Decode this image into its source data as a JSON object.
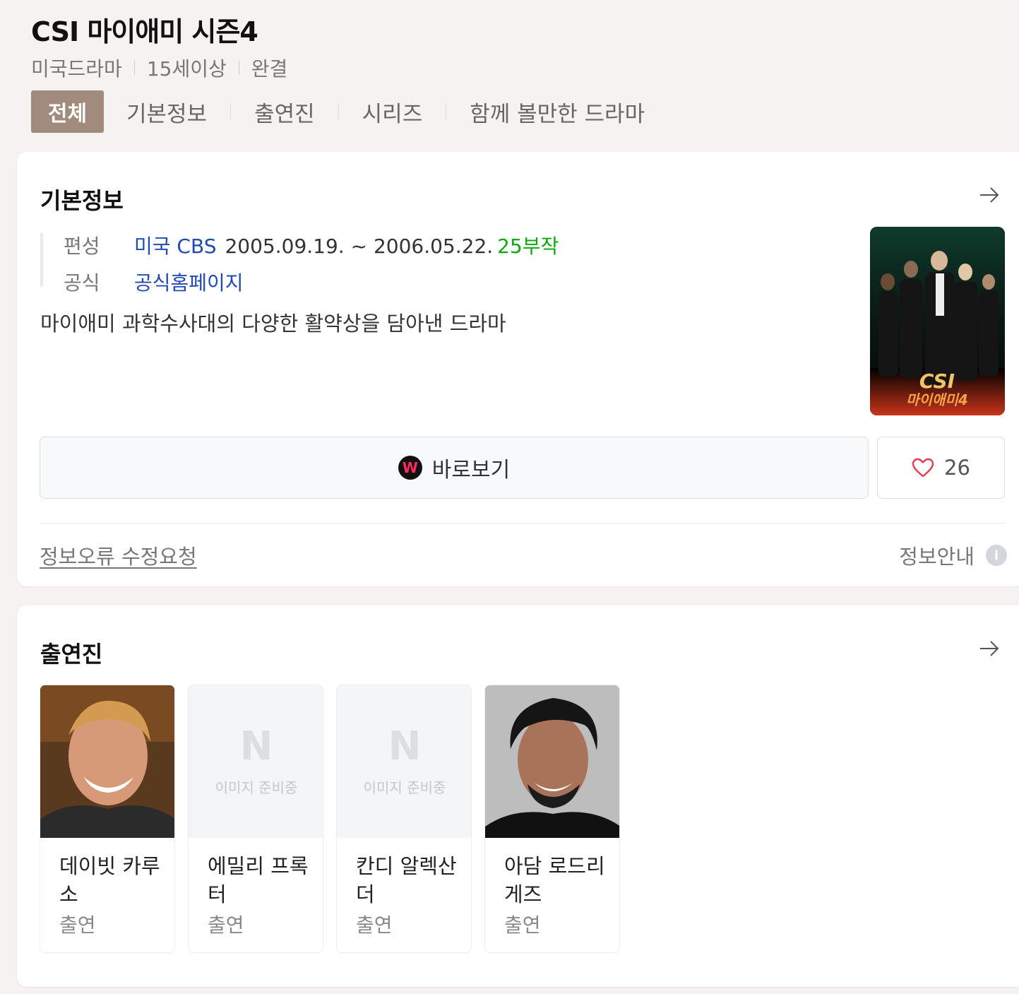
{
  "header": {
    "title": "CSI 마이애미 시즌4",
    "meta": [
      "미국드라마",
      "15세이상",
      "완결"
    ],
    "tabs": [
      {
        "label": "전체",
        "active": true
      },
      {
        "label": "기본정보"
      },
      {
        "label": "출연진"
      },
      {
        "label": "시리즈"
      },
      {
        "label": "함께 볼만한 드라마"
      }
    ]
  },
  "basic": {
    "title": "기본정보",
    "broadcast_label": "편성",
    "network": "미국 CBS",
    "dates": "2005.09.19. ~ 2006.05.22.",
    "episodes": "25부작",
    "official_label": "공식",
    "homepage": "공식홈페이지",
    "description": "마이애미 과학수사대의 다양한 활약상을 담아낸 드라마",
    "poster_text_1": "CSI",
    "poster_text_2": "마이애미4",
    "watch_label": "바로보기",
    "watch_icon_letter": "W",
    "like_count": "26",
    "report_label": "정보오류 수정요청",
    "info_guide_label": "정보안내",
    "info_icon": "i"
  },
  "cast": {
    "title": "출연진",
    "placeholder_logo": "N",
    "placeholder_text": "이미지 준비중",
    "members": [
      {
        "name": "데이빗 카루소",
        "role": "출연"
      },
      {
        "name": "에밀리 프록터",
        "role": "출연"
      },
      {
        "name": "칸디 알렉산더",
        "role": "출연"
      },
      {
        "name": "아담 로드리게즈",
        "role": "출연"
      }
    ]
  },
  "colors": {
    "accent_tab": "#a08b7d",
    "link_blue": "#1f4bb3",
    "episodes_green": "#0ba90b",
    "heart_red": "#e23c4f"
  }
}
